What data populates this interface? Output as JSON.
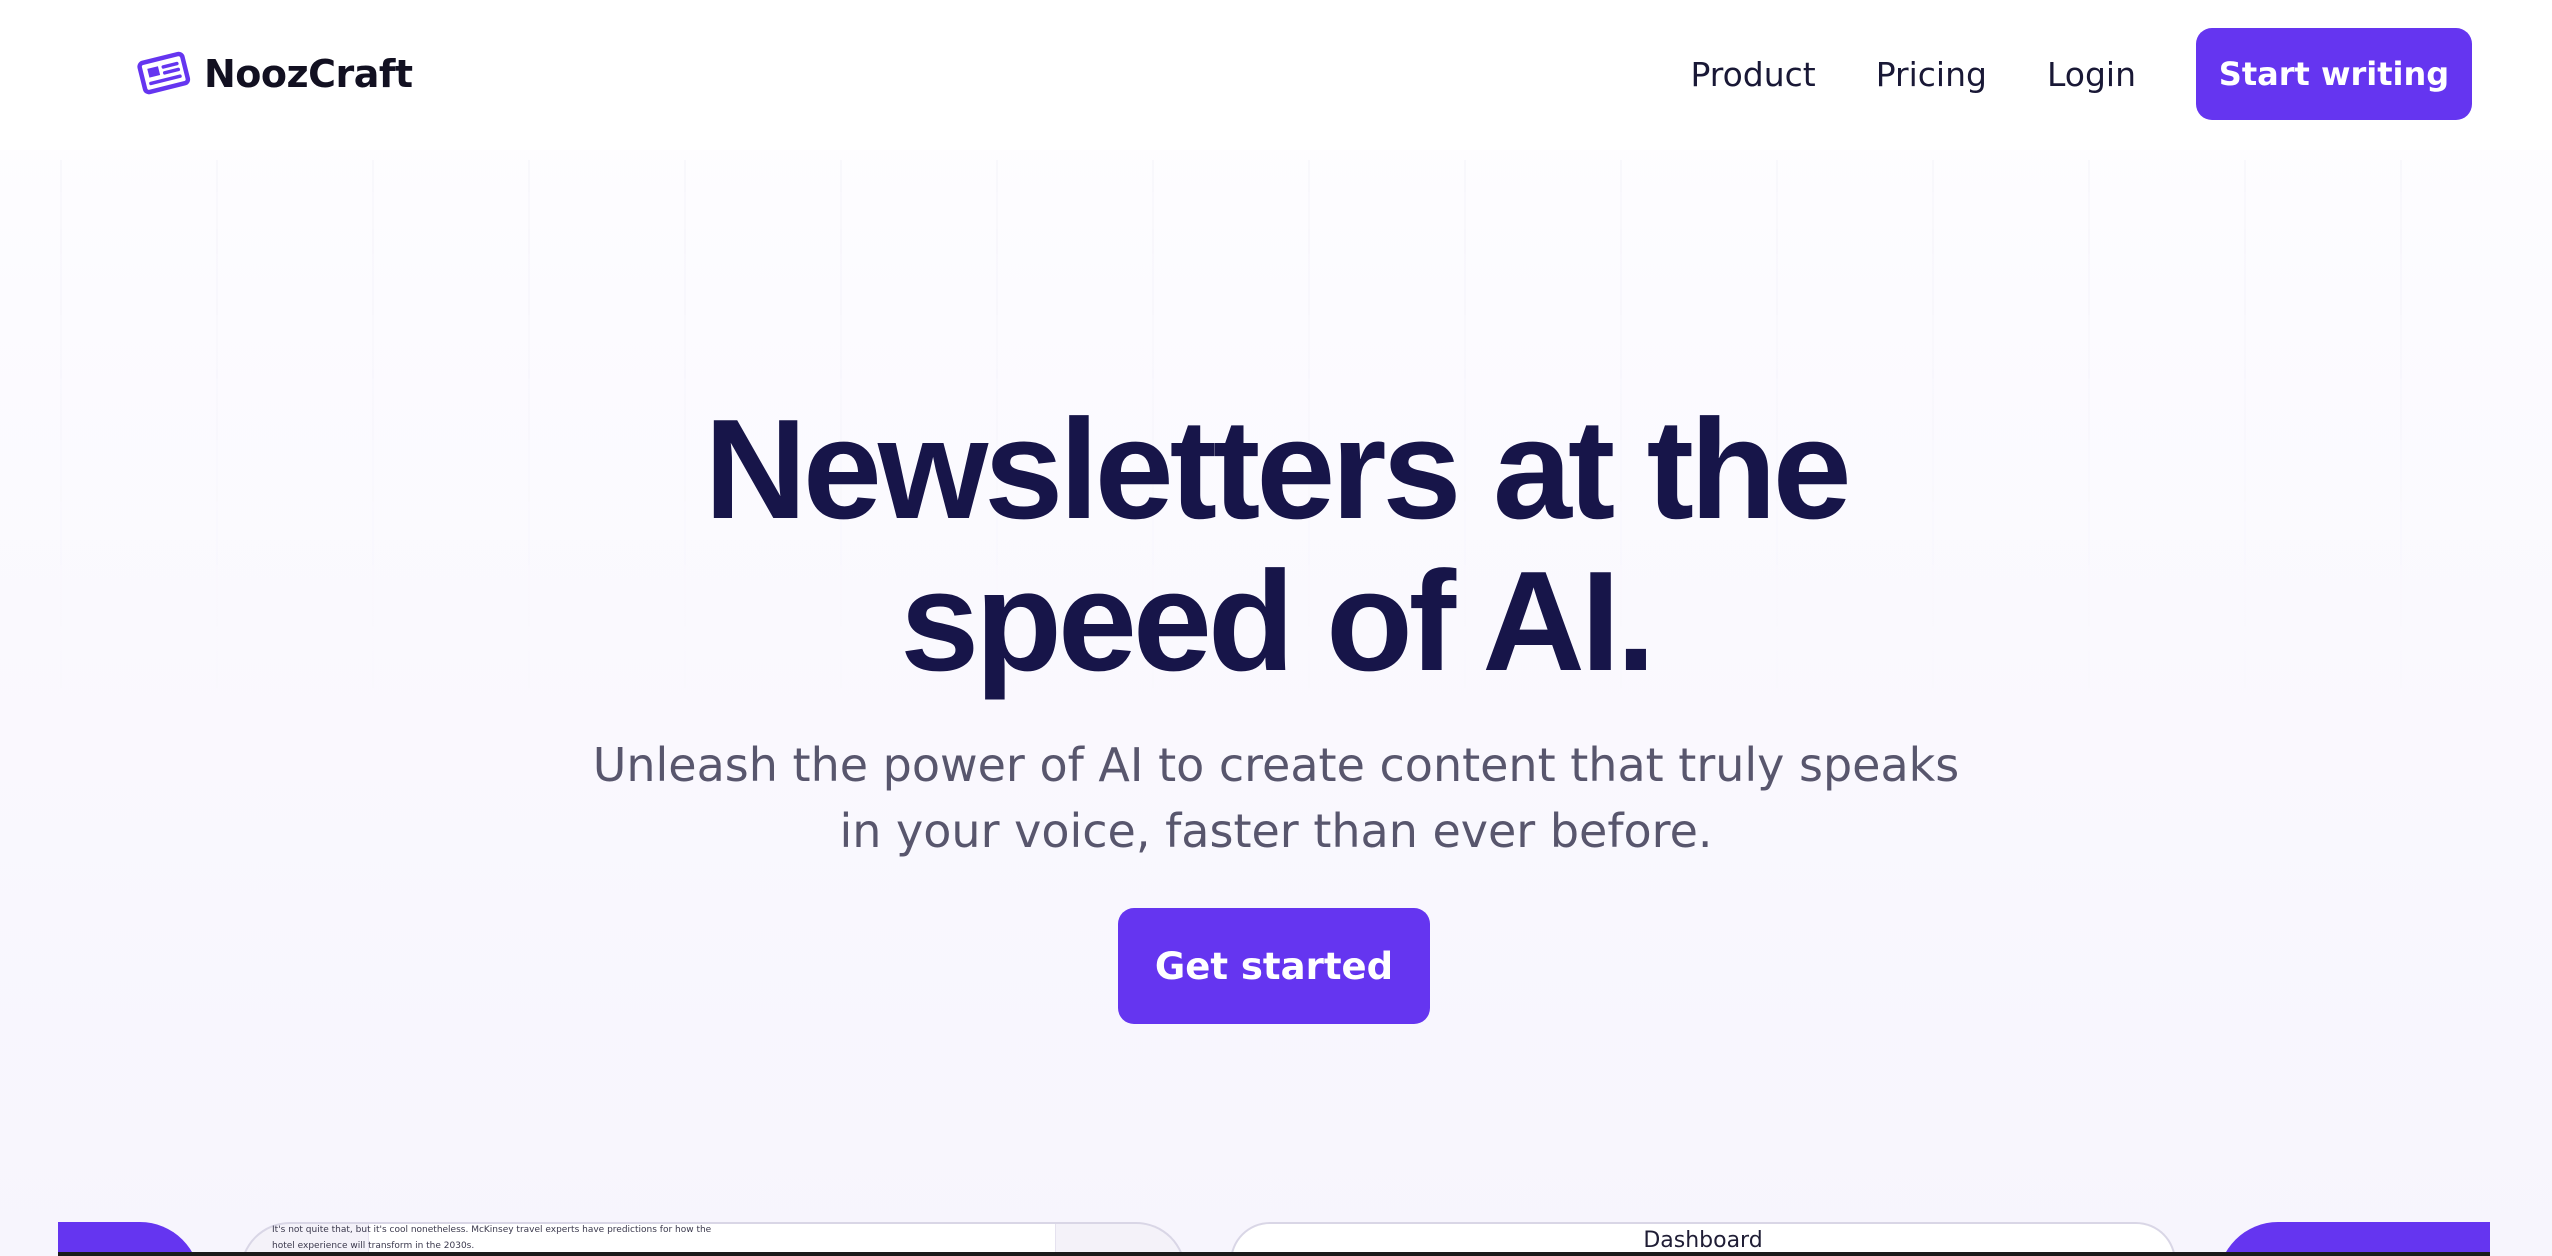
{
  "brand": {
    "name": "NoozCraft",
    "icon": "newspaper-icon",
    "accent_color": "#6535f0",
    "text_color": "#171549"
  },
  "nav": {
    "links": [
      "Product",
      "Pricing",
      "Login"
    ],
    "cta_label": "Start writing"
  },
  "hero": {
    "title_line1": "Newsletters at the",
    "title_line2": "speed of AI.",
    "subtitle_line1": "Unleash the power of AI to create content that truly speaks",
    "subtitle_line2": "in your voice, faster than ever before.",
    "cta_label": "Get started"
  },
  "preview": {
    "snippet_line1": "It's not quite that, but it's cool nonetheless. McKinsey travel experts have predictions for how the",
    "snippet_line2": "hotel experience will transform in the 2030s.",
    "dashboard_title": "Dashboard"
  }
}
